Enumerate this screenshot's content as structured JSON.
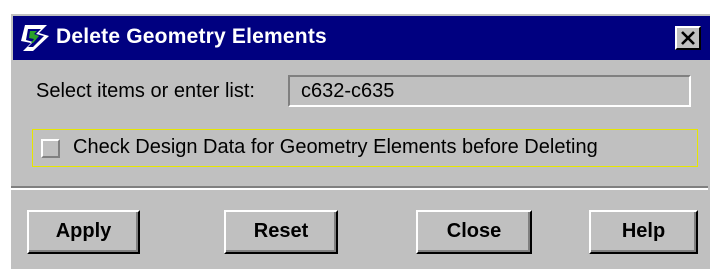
{
  "window": {
    "title": "Delete Geometry Elements",
    "close_glyph": "✕",
    "icon": "bentley-b-icon",
    "colors": {
      "titlebar": "#000080",
      "face": "#c0c0c0",
      "focus_border": "#e6e600"
    }
  },
  "select": {
    "label": "Select items or enter list:",
    "value": "c632-c635"
  },
  "checkbox": {
    "label": "Check Design Data for Geometry Elements before Deleting",
    "checked": false
  },
  "buttons": {
    "apply": "Apply",
    "reset": "Reset",
    "close": "Close",
    "help": "Help"
  }
}
